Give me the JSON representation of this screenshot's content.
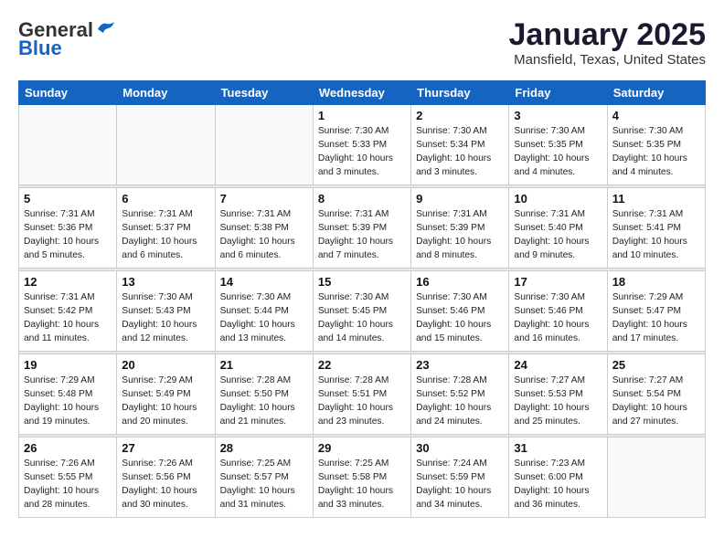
{
  "header": {
    "logo_general": "General",
    "logo_blue": "Blue",
    "month": "January 2025",
    "location": "Mansfield, Texas, United States"
  },
  "weekdays": [
    "Sunday",
    "Monday",
    "Tuesday",
    "Wednesday",
    "Thursday",
    "Friday",
    "Saturday"
  ],
  "weeks": [
    [
      {
        "day": "",
        "info": ""
      },
      {
        "day": "",
        "info": ""
      },
      {
        "day": "",
        "info": ""
      },
      {
        "day": "1",
        "info": "Sunrise: 7:30 AM\nSunset: 5:33 PM\nDaylight: 10 hours\nand 3 minutes."
      },
      {
        "day": "2",
        "info": "Sunrise: 7:30 AM\nSunset: 5:34 PM\nDaylight: 10 hours\nand 3 minutes."
      },
      {
        "day": "3",
        "info": "Sunrise: 7:30 AM\nSunset: 5:35 PM\nDaylight: 10 hours\nand 4 minutes."
      },
      {
        "day": "4",
        "info": "Sunrise: 7:30 AM\nSunset: 5:35 PM\nDaylight: 10 hours\nand 4 minutes."
      }
    ],
    [
      {
        "day": "5",
        "info": "Sunrise: 7:31 AM\nSunset: 5:36 PM\nDaylight: 10 hours\nand 5 minutes."
      },
      {
        "day": "6",
        "info": "Sunrise: 7:31 AM\nSunset: 5:37 PM\nDaylight: 10 hours\nand 6 minutes."
      },
      {
        "day": "7",
        "info": "Sunrise: 7:31 AM\nSunset: 5:38 PM\nDaylight: 10 hours\nand 6 minutes."
      },
      {
        "day": "8",
        "info": "Sunrise: 7:31 AM\nSunset: 5:39 PM\nDaylight: 10 hours\nand 7 minutes."
      },
      {
        "day": "9",
        "info": "Sunrise: 7:31 AM\nSunset: 5:39 PM\nDaylight: 10 hours\nand 8 minutes."
      },
      {
        "day": "10",
        "info": "Sunrise: 7:31 AM\nSunset: 5:40 PM\nDaylight: 10 hours\nand 9 minutes."
      },
      {
        "day": "11",
        "info": "Sunrise: 7:31 AM\nSunset: 5:41 PM\nDaylight: 10 hours\nand 10 minutes."
      }
    ],
    [
      {
        "day": "12",
        "info": "Sunrise: 7:31 AM\nSunset: 5:42 PM\nDaylight: 10 hours\nand 11 minutes."
      },
      {
        "day": "13",
        "info": "Sunrise: 7:30 AM\nSunset: 5:43 PM\nDaylight: 10 hours\nand 12 minutes."
      },
      {
        "day": "14",
        "info": "Sunrise: 7:30 AM\nSunset: 5:44 PM\nDaylight: 10 hours\nand 13 minutes."
      },
      {
        "day": "15",
        "info": "Sunrise: 7:30 AM\nSunset: 5:45 PM\nDaylight: 10 hours\nand 14 minutes."
      },
      {
        "day": "16",
        "info": "Sunrise: 7:30 AM\nSunset: 5:46 PM\nDaylight: 10 hours\nand 15 minutes."
      },
      {
        "day": "17",
        "info": "Sunrise: 7:30 AM\nSunset: 5:46 PM\nDaylight: 10 hours\nand 16 minutes."
      },
      {
        "day": "18",
        "info": "Sunrise: 7:29 AM\nSunset: 5:47 PM\nDaylight: 10 hours\nand 17 minutes."
      }
    ],
    [
      {
        "day": "19",
        "info": "Sunrise: 7:29 AM\nSunset: 5:48 PM\nDaylight: 10 hours\nand 19 minutes."
      },
      {
        "day": "20",
        "info": "Sunrise: 7:29 AM\nSunset: 5:49 PM\nDaylight: 10 hours\nand 20 minutes."
      },
      {
        "day": "21",
        "info": "Sunrise: 7:28 AM\nSunset: 5:50 PM\nDaylight: 10 hours\nand 21 minutes."
      },
      {
        "day": "22",
        "info": "Sunrise: 7:28 AM\nSunset: 5:51 PM\nDaylight: 10 hours\nand 23 minutes."
      },
      {
        "day": "23",
        "info": "Sunrise: 7:28 AM\nSunset: 5:52 PM\nDaylight: 10 hours\nand 24 minutes."
      },
      {
        "day": "24",
        "info": "Sunrise: 7:27 AM\nSunset: 5:53 PM\nDaylight: 10 hours\nand 25 minutes."
      },
      {
        "day": "25",
        "info": "Sunrise: 7:27 AM\nSunset: 5:54 PM\nDaylight: 10 hours\nand 27 minutes."
      }
    ],
    [
      {
        "day": "26",
        "info": "Sunrise: 7:26 AM\nSunset: 5:55 PM\nDaylight: 10 hours\nand 28 minutes."
      },
      {
        "day": "27",
        "info": "Sunrise: 7:26 AM\nSunset: 5:56 PM\nDaylight: 10 hours\nand 30 minutes."
      },
      {
        "day": "28",
        "info": "Sunrise: 7:25 AM\nSunset: 5:57 PM\nDaylight: 10 hours\nand 31 minutes."
      },
      {
        "day": "29",
        "info": "Sunrise: 7:25 AM\nSunset: 5:58 PM\nDaylight: 10 hours\nand 33 minutes."
      },
      {
        "day": "30",
        "info": "Sunrise: 7:24 AM\nSunset: 5:59 PM\nDaylight: 10 hours\nand 34 minutes."
      },
      {
        "day": "31",
        "info": "Sunrise: 7:23 AM\nSunset: 6:00 PM\nDaylight: 10 hours\nand 36 minutes."
      },
      {
        "day": "",
        "info": ""
      }
    ]
  ]
}
